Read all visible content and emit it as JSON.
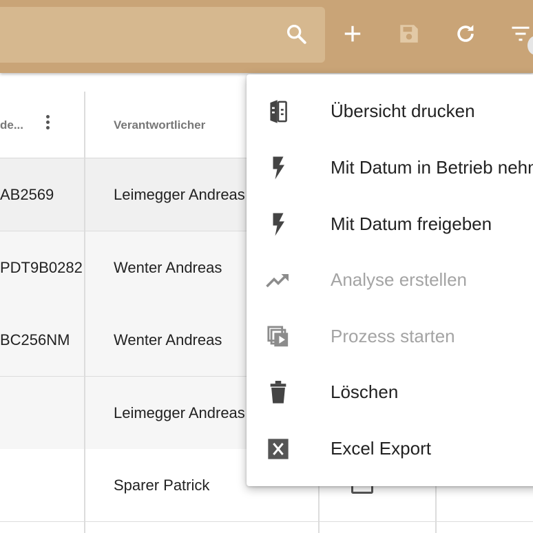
{
  "toolbar": {
    "search_icon": "search-icon",
    "add_icon": "plus-icon",
    "save_icon": "save-icon",
    "refresh_icon": "refresh-icon",
    "filter_icon": "filter-icon"
  },
  "table": {
    "columns": [
      "de...",
      "Verantwortlicher"
    ],
    "rows": [
      {
        "code": "AB2569",
        "owner": "Leimegger Andreas"
      },
      {
        "code": "PDT9B0282",
        "owner": "Wenter Andreas"
      },
      {
        "code": "BC256NM",
        "owner": "Wenter Andreas"
      },
      {
        "code": "",
        "owner": "Leimegger Andreas"
      },
      {
        "code": "",
        "owner": "Sparer Patrick"
      }
    ]
  },
  "menu": {
    "items": [
      {
        "label": "Übersicht drucken",
        "icon": "print-overview-icon",
        "enabled": true
      },
      {
        "label": "Mit Datum in Betrieb nehmen",
        "icon": "flash-icon",
        "enabled": true
      },
      {
        "label": "Mit Datum freigeben",
        "icon": "flash-icon",
        "enabled": true
      },
      {
        "label": "Analyse erstellen",
        "icon": "trending-up-icon",
        "enabled": false
      },
      {
        "label": "Prozess starten",
        "icon": "play-queue-icon",
        "enabled": false
      },
      {
        "label": "Löschen",
        "icon": "trash-icon",
        "enabled": true
      },
      {
        "label": "Excel Export",
        "icon": "excel-icon",
        "enabled": true
      }
    ]
  },
  "colors": {
    "topbar": "#c9a477",
    "search_field": "#d6b88f",
    "icon_white": "#ffffff",
    "icon_disabled": "#e2c9a6",
    "menu_text": "#222222",
    "menu_text_disabled": "#a4a4a4",
    "menu_icon": "#444444",
    "menu_icon_disabled": "#8c8c8c"
  }
}
